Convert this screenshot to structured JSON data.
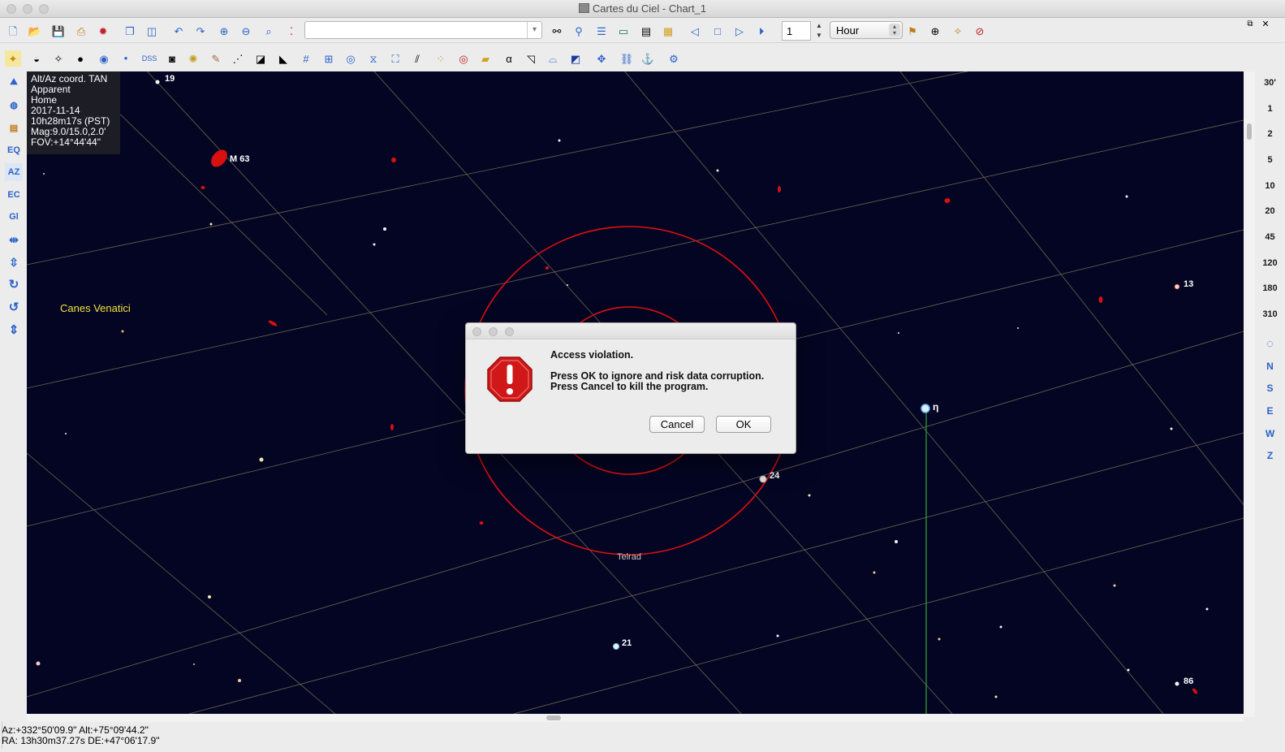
{
  "window": {
    "title": "Cartes du Ciel - Chart_1"
  },
  "toolbar": {
    "object_search_value": "",
    "step_value": "1",
    "time_unit": "Hour",
    "dss_label": "DSS",
    "alpha_label": "α"
  },
  "left_toolbar": {
    "eq_label": "EQ",
    "az_label": "AZ",
    "ec_label": "EC",
    "gl_label": "Gl"
  },
  "right_toolbar": {
    "fov_buttons": [
      "30'",
      "1",
      "2",
      "5",
      "10",
      "20",
      "45",
      "120",
      "180",
      "310"
    ],
    "direction_buttons": [
      "N",
      "S",
      "E",
      "W",
      "Z"
    ]
  },
  "chart": {
    "info": [
      "Alt/Az coord. TAN",
      "Apparent",
      "Home",
      "2017-11-14",
      "10h28m17s (PST)",
      "Mag:9.0/15.0,2.0'",
      "FOV:+14°44'44\""
    ],
    "constellation": "Canes Venatici",
    "labels": {
      "m63": "M 63",
      "s19": "19",
      "s13": "13",
      "eta": "η",
      "s24": "24",
      "s21": "21",
      "s86": "86",
      "telrad": "Telrad"
    },
    "colors": {
      "background": "#040523",
      "grid": "#6b6450",
      "telrad": "#e01010",
      "constellation_label": "#f2e33a",
      "meridian": "#2fa52f"
    }
  },
  "status": {
    "altaz": "Az:+332°50'09.9\" Alt:+75°09'44.2\"",
    "radec": "RA: 13h30m37.27s DE:+47°06'17.9\""
  },
  "dialog": {
    "title": "",
    "heading": "Access violation.",
    "line1": "Press OK to ignore and risk data corruption.",
    "line2": "Press Cancel to kill the program.",
    "cancel_label": "Cancel",
    "ok_label": "OK",
    "icon": "error-exclamation-icon"
  }
}
